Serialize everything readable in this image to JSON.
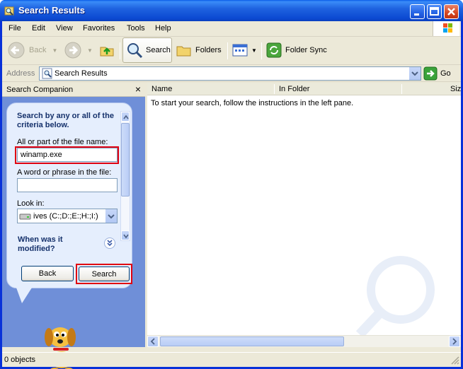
{
  "window": {
    "title": "Search Results"
  },
  "menu": {
    "file": "File",
    "edit": "Edit",
    "view": "View",
    "favorites": "Favorites",
    "tools": "Tools",
    "help": "Help"
  },
  "toolbar": {
    "back": "Back",
    "search": "Search",
    "folders": "Folders",
    "folder_sync": "Folder Sync"
  },
  "address": {
    "label": "Address",
    "value": "Search Results",
    "go": "Go"
  },
  "companion": {
    "title": "Search Companion",
    "close_glyph": "×",
    "heading": "Search by any or all of the criteria below.",
    "filename_label": "All or part of the file name:",
    "filename_value": "winamp.exe",
    "phrase_label": "A word or phrase in the file:",
    "phrase_value": "",
    "lookin_label": "Look in:",
    "lookin_value": "ives (C:;D:;E:;H:;I:)",
    "when_modified": "When was it modified?",
    "back_button": "Back",
    "search_button": "Search"
  },
  "results": {
    "columns": [
      "Name",
      "In Folder",
      "Siz"
    ],
    "empty_message": "To start your search, follow the instructions in the left pane."
  },
  "status": {
    "text": "0 objects"
  },
  "colors": {
    "titlebar": "#0c4ad2",
    "highlight": "#e00010",
    "pane_blue": "#6f8fd8"
  }
}
